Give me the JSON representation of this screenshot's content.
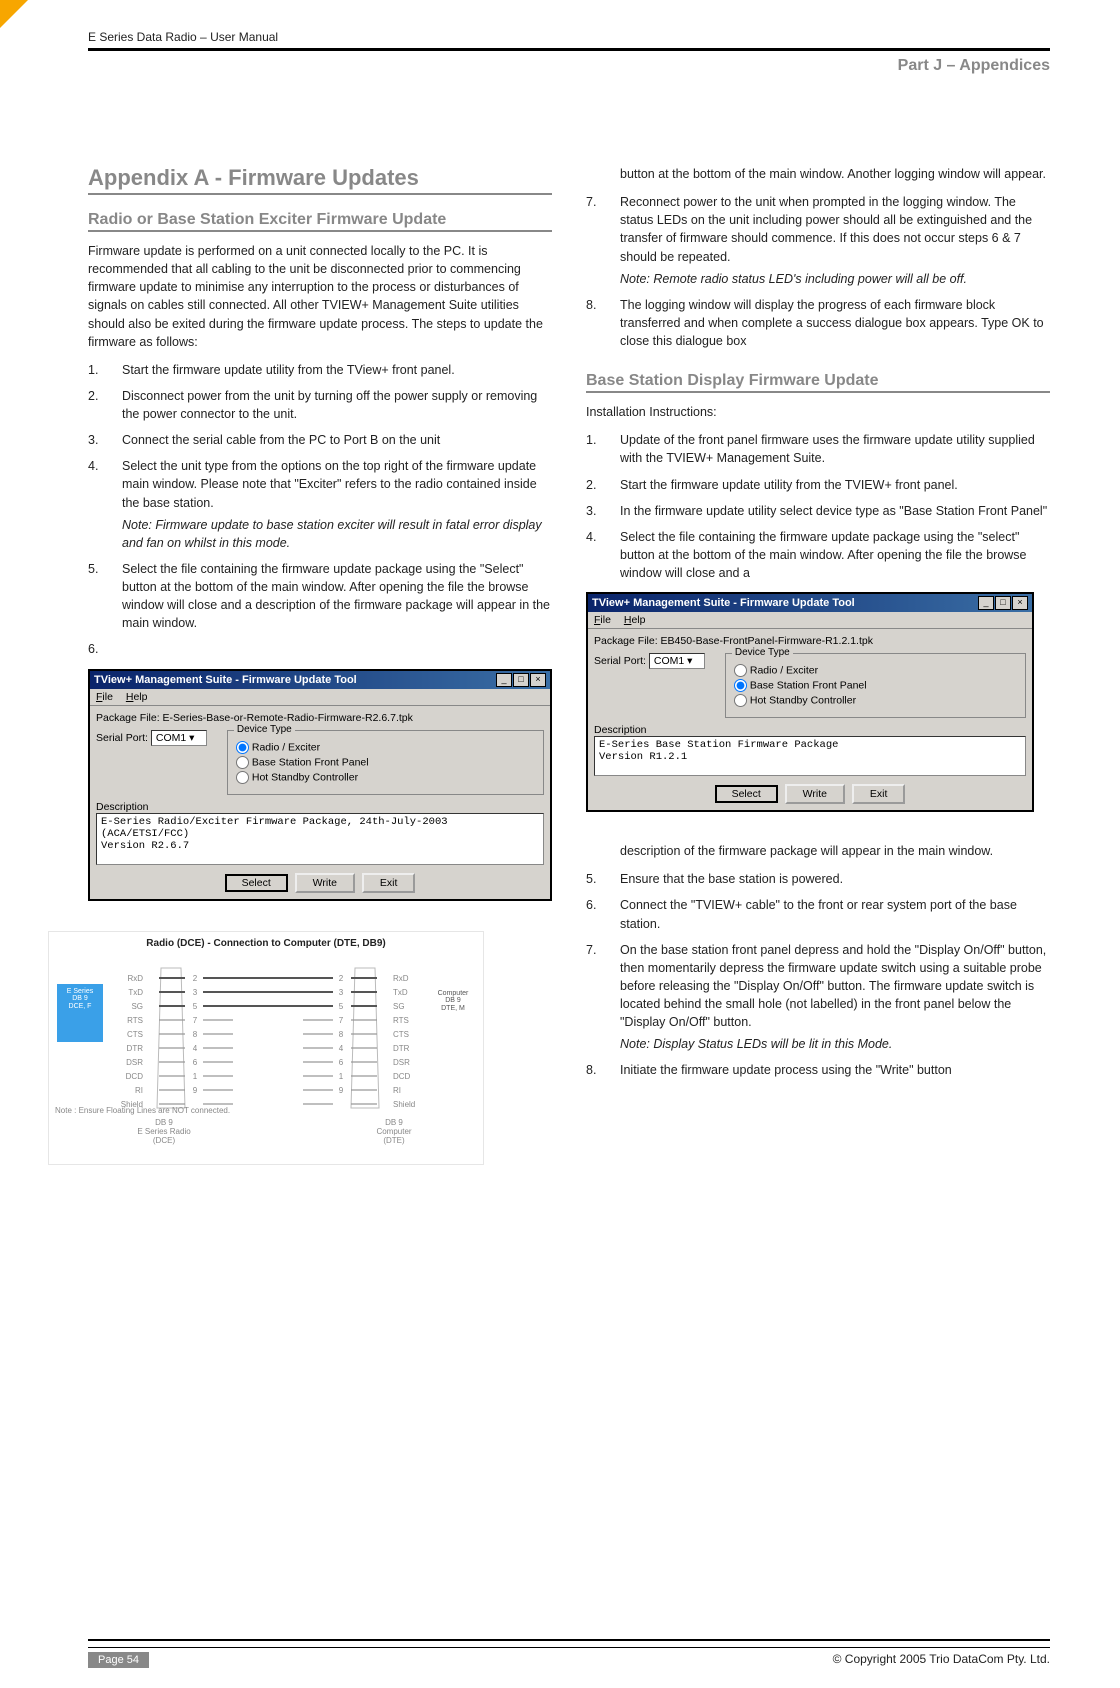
{
  "doc_title": "E Series Data Radio – User Manual",
  "part_label": "Part J – Appendices",
  "left": {
    "appendix_title": "Appendix A - Firmware Updates",
    "section_title": "Radio or Base Station Exciter Firmware Update",
    "intro": "Firmware update is performed on a unit connected locally to the PC. It is recommended that all cabling to the unit be disconnected prior to commencing firmware update to minimise any interruption to the process or disturbances of signals on cables still connected. All other TVIEW+ Management Suite utilities should also be exited during the firmware update process. The steps to update the firmware as follows:",
    "steps": [
      {
        "n": "1.",
        "t": "Start the firmware update utility from the TView+ front panel."
      },
      {
        "n": "2.",
        "t": "Disconnect power from the unit by turning off the power supply or removing the power connector to the unit."
      },
      {
        "n": "3.",
        "t": "Connect the serial cable from the PC to Port B on the unit"
      },
      {
        "n": "4.",
        "t": "Select the unit type from the options on the top right of the firmware update main window. Please note that \"Exciter\" refers to the radio contained inside the base station.",
        "note": "Note: Firmware update to base station exciter will result in fatal error display and fan on whilst in this mode."
      },
      {
        "n": "5.",
        "t": "Select the file containing the firmware update package using the \"Select\" button at the bottom of the main window. After opening the file the browse window will close and a description of the firmware package will appear in the main window."
      },
      {
        "n": "6.",
        "t": ""
      }
    ],
    "fw": {
      "title": "TView+ Management Suite - Firmware Update Tool",
      "menu": {
        "file": "File",
        "help": "Help"
      },
      "pkg_label": "Package File:",
      "pkg_value": "E-Series-Base-or-Remote-Radio-Firmware-R2.6.7.tpk",
      "serial_label": "Serial Port:",
      "serial_value": "COM1",
      "devtype": "Device Type",
      "opt1": "Radio / Exciter",
      "opt2": "Base Station Front Panel",
      "opt3": "Hot Standby Controller",
      "desc_label": "Description",
      "desc_text": "E-Series Radio/Exciter Firmware Package, 24th-July-2003 (ACA/ETSI/FCC)\nVersion R2.6.7",
      "btn_select": "Select",
      "btn_write": "Write",
      "btn_exit": "Exit"
    },
    "diagram": {
      "title": "Radio (DCE) - Connection to Computer (DTE, DB9)",
      "box_left": "E Series\nDB 9\nDCE, F",
      "box_right": "Computer\nDB 9\nDTE, M",
      "note": "Note : Ensure Floating Lines are NOT connected.",
      "db9l": "DB 9\nE Series Radio\n(DCE)",
      "db9r": "DB 9\nComputer\n(DTE)",
      "pins": {
        "l": [
          "RxD",
          "TxD",
          "SG",
          "RTS",
          "CTS",
          "DTR",
          "DSR",
          "DCD",
          "RI",
          "Shield"
        ],
        "ln": [
          "2",
          "3",
          "5",
          "7",
          "8",
          "4",
          "6",
          "1",
          "9",
          ""
        ],
        "rn": [
          "2",
          "3",
          "5",
          "7",
          "8",
          "4",
          "6",
          "1",
          "9",
          ""
        ],
        "r": [
          "RxD",
          "TxD",
          "SG",
          "RTS",
          "CTS",
          "DTR",
          "DSR",
          "DCD",
          "RI",
          "Shield"
        ]
      }
    }
  },
  "right": {
    "cont_step6": "button at the bottom of the main window. Another logging window will appear.",
    "steps_a": [
      {
        "n": "7.",
        "t": "Reconnect power to the unit when prompted in the logging window. The status LEDs on the unit including power should all be extinguished and the transfer of firmware should commence. If this does not occur steps 6 & 7 should be repeated.",
        "note": "Note: Remote radio status LED's including power will all be off."
      },
      {
        "n": "8.",
        "t": "The logging window will display the progress of each firmware block transferred and when complete a success dialogue box appears. Type OK to close this dialogue box"
      }
    ],
    "section_title": "Base Station Display Firmware Update",
    "intro": "Installation Instructions:",
    "steps_b": [
      {
        "n": "1.",
        "t": "Update of the front panel firmware uses the firmware update utility supplied with the TVIEW+ Management Suite."
      },
      {
        "n": "2.",
        "t": "Start the firmware update utility from the TVIEW+ front panel."
      },
      {
        "n": "3.",
        "t": "In the firmware update utility select device type as \"Base Station Front Panel\""
      },
      {
        "n": "4.",
        "t": "Select the file containing the firmware update package using the \"select\" button at the bottom of the main window. After opening the file the browse window will close and a"
      }
    ],
    "fw": {
      "title": "TView+ Management Suite - Firmware Update Tool",
      "menu": {
        "file": "File",
        "help": "Help"
      },
      "pkg_label": "Package File:",
      "pkg_value": "EB450-Base-FrontPanel-Firmware-R1.2.1.tpk",
      "serial_label": "Serial Port:",
      "serial_value": "COM1",
      "devtype": "Device Type",
      "opt1": "Radio / Exciter",
      "opt2": "Base Station Front Panel",
      "opt3": "Hot Standby Controller",
      "desc_label": "Description",
      "desc_text": "E-Series Base Station Firmware Package\nVersion R1.2.1",
      "btn_select": "Select",
      "btn_write": "Write",
      "btn_exit": "Exit"
    },
    "after_fw": "description of the firmware package will appear in the main window.",
    "steps_c": [
      {
        "n": "5.",
        "t": "Ensure that the base station is powered."
      },
      {
        "n": "6.",
        "t": "Connect the \"TVIEW+ cable\" to the front or rear system port of the base station."
      },
      {
        "n": "7.",
        "t": "On the base station front panel depress and hold the \"Display On/Off\" button, then momentarily depress the firmware update switch using a suitable probe before releasing the \"Display On/Off\" button. The firmware update switch is located behind the small hole (not labelled) in the front panel below the \"Display On/Off\" button.",
        "note": "Note: Display Status LEDs will be lit in this Mode."
      },
      {
        "n": "8.",
        "t": "Initiate the firmware update process using the \"Write\" button"
      }
    ]
  },
  "footer": {
    "page": "Page 54",
    "copyright": "© Copyright 2005 Trio DataCom Pty. Ltd."
  }
}
